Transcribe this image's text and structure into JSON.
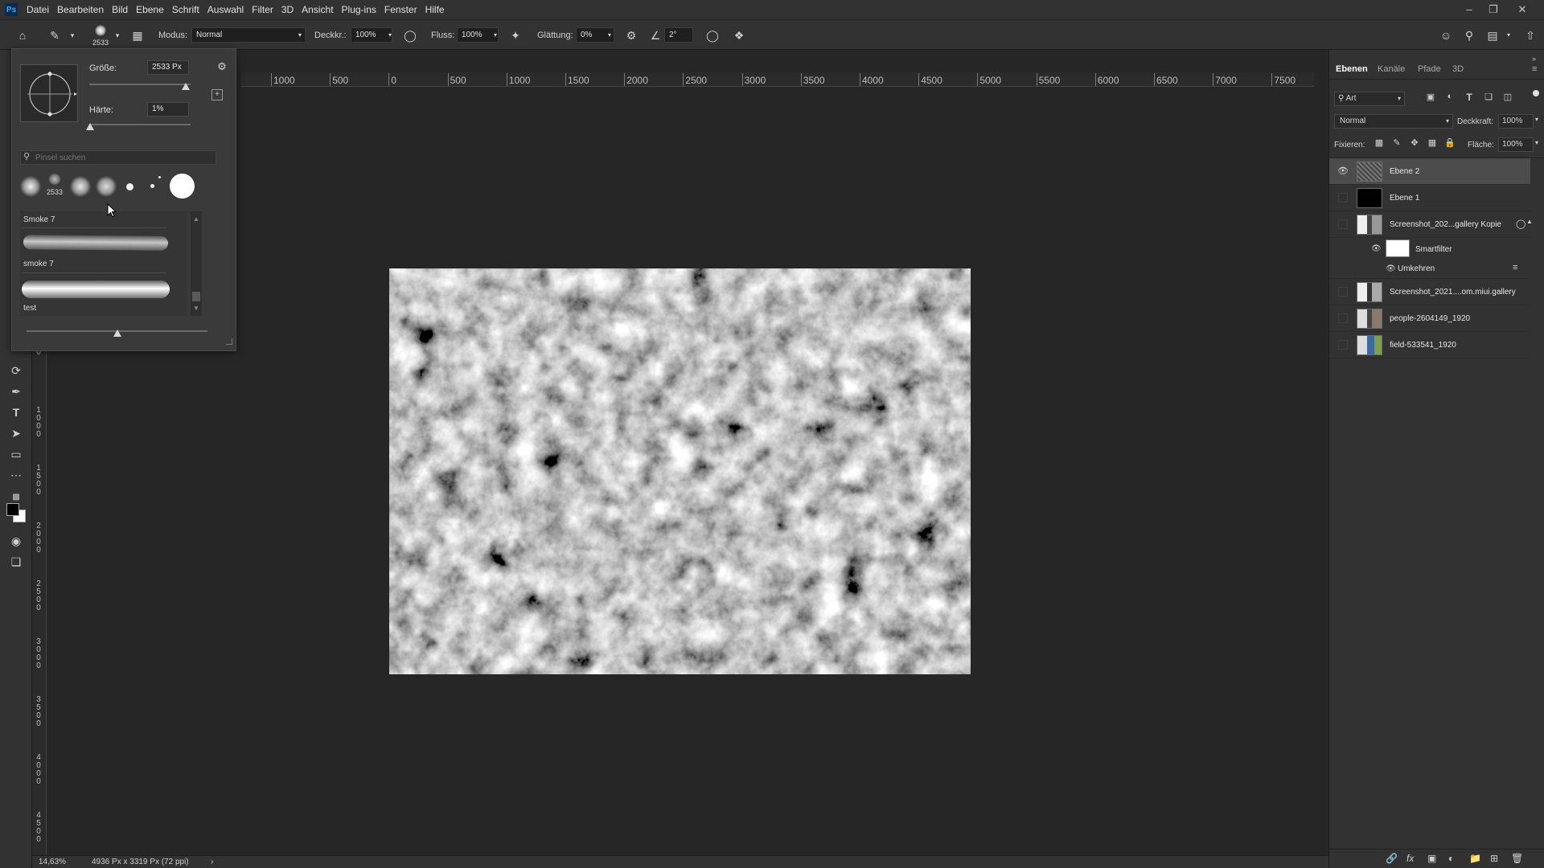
{
  "app": {
    "logo": "Ps"
  },
  "menu": [
    "Datei",
    "Bearbeiten",
    "Bild",
    "Ebene",
    "Schrift",
    "Auswahl",
    "Filter",
    "3D",
    "Ansicht",
    "Plug-ins",
    "Fenster",
    "Hilfe"
  ],
  "options": {
    "brush_size_label": "2533",
    "modus_label": "Modus:",
    "modus_value": "Normal",
    "deckkraft_label": "Deckkr.:",
    "deckkraft_value": "100%",
    "fluss_label": "Fluss:",
    "fluss_value": "100%",
    "glaettung_label": "Glättung:",
    "glaettung_value": "0%",
    "angle_value": "2°"
  },
  "brush_panel": {
    "size_label": "Größe:",
    "size_value": "2533 Px",
    "size_fraction": 0.95,
    "hardness_label": "Härte:",
    "hardness_value": "1%",
    "hardness_fraction": 0.01,
    "search_placeholder": "Pinsel suchen",
    "recent_brush_label": "2533",
    "brushes": [
      {
        "name": "Smoke 7"
      },
      {
        "name": "smoke 7"
      },
      {
        "name": "test"
      }
    ],
    "preview_size_fraction": 0.5
  },
  "ruler": {
    "h_ticks": [
      "1000",
      "500",
      "0",
      "500",
      "1000",
      "1500",
      "2000",
      "2500",
      "3000",
      "3500",
      "4000",
      "4500",
      "5000",
      "5500",
      "6000",
      "6500",
      "7000",
      "7500"
    ],
    "v_ticks": [
      "0",
      "1000",
      "1500",
      "2000",
      "2500",
      "3000",
      "3500",
      "4000",
      "4500"
    ]
  },
  "layers_panel": {
    "tabs": [
      "Ebenen",
      "Kanäle",
      "Pfade",
      "3D"
    ],
    "filter_label": "Art",
    "blend_mode": "Normal",
    "opacity_label": "Deckkraft:",
    "opacity_value": "100%",
    "lock_label": "Fixieren:",
    "fill_label": "Fläche:",
    "fill_value": "100%",
    "layers": [
      {
        "name": "Ebene 2",
        "visible": true,
        "selected": true
      },
      {
        "name": "Ebene 1",
        "visible": false,
        "selected": false
      },
      {
        "name": "Screenshot_202...gallery Kopie",
        "visible": false,
        "selected": false
      },
      {
        "name": "Smartfilter",
        "visible": true,
        "selected": false,
        "sub": true
      },
      {
        "name": "Umkehren",
        "visible": true,
        "selected": false,
        "sub": true
      },
      {
        "name": "Screenshot_2021....om.miui.gallery",
        "visible": false,
        "selected": false
      },
      {
        "name": "people-2604149_1920",
        "visible": false,
        "selected": false
      },
      {
        "name": "field-533541_1920",
        "visible": false,
        "selected": false
      }
    ]
  },
  "status": {
    "zoom": "14,63%",
    "doc_info": "4936 Px x 3319 Px (72 ppi)"
  },
  "colors": {
    "ui_bg": "#323232",
    "workspace": "#262626",
    "selected_layer": "#4c4c4c"
  }
}
